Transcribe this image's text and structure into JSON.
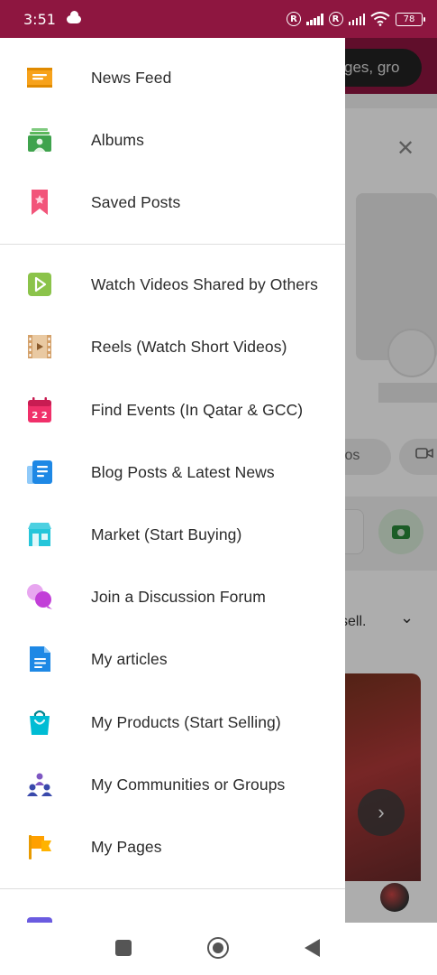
{
  "status_bar": {
    "time": "3:51",
    "battery": "78",
    "sim1": "R",
    "sim2": "R"
  },
  "background": {
    "search_placeholder": "ges, gro",
    "photos_pill": "tos",
    "sell_text": "sell."
  },
  "menu": {
    "group1": [
      {
        "label": "News Feed",
        "icon": "news-feed-icon"
      },
      {
        "label": "Albums",
        "icon": "albums-icon"
      },
      {
        "label": "Saved Posts",
        "icon": "bookmark-icon"
      }
    ],
    "group2": [
      {
        "label": "Watch Videos Shared by Others",
        "icon": "play-icon"
      },
      {
        "label": "Reels (Watch Short Videos)",
        "icon": "film-reel-icon"
      },
      {
        "label": "Find Events (In Qatar & GCC)",
        "icon": "calendar-icon"
      },
      {
        "label": "Blog Posts & Latest News",
        "icon": "newspaper-icon"
      },
      {
        "label": "Market (Start Buying)",
        "icon": "storefront-icon"
      },
      {
        "label": "Join a Discussion Forum",
        "icon": "chat-bubbles-icon"
      },
      {
        "label": "My articles",
        "icon": "document-icon"
      },
      {
        "label": "My Products (Start Selling)",
        "icon": "shopping-bag-icon"
      },
      {
        "label": "My Communities or Groups",
        "icon": "people-group-icon"
      },
      {
        "label": "My Pages",
        "icon": "flag-icon"
      }
    ]
  },
  "colors": {
    "brand": "#8e1640",
    "scrim": "rgba(0,0,0,0.32)",
    "text": "#2a2a2a"
  }
}
